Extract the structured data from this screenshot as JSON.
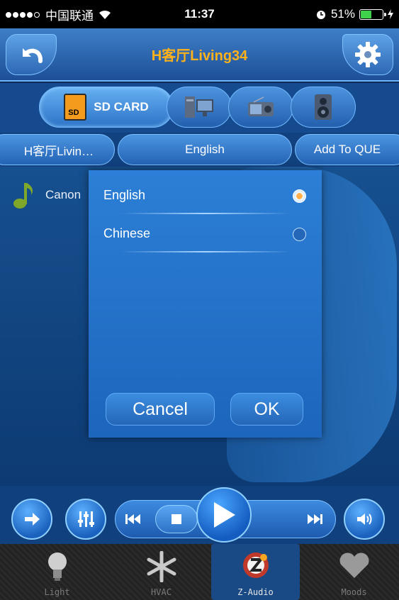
{
  "status_bar": {
    "carrier": "中国联通",
    "time": "11:37",
    "battery": "51%",
    "battery_level": 0.51
  },
  "header": {
    "title": "H客厅Living34",
    "back_icon": "back-arrow-icon",
    "settings_icon": "gear-icon"
  },
  "sources": [
    {
      "label": "SD CARD",
      "icon": "sd-card-icon",
      "selected": true
    },
    {
      "label": "",
      "icon": "pc-tower-icon",
      "selected": false
    },
    {
      "label": "",
      "icon": "radio-icon",
      "selected": false
    },
    {
      "label": "",
      "icon": "speaker-icon",
      "selected": false
    }
  ],
  "nav": {
    "room": "H客厅Livin…",
    "language": "English",
    "add_queue": "Add To QUE"
  },
  "track": {
    "name": "Canon"
  },
  "dialog": {
    "options": [
      {
        "label": "English",
        "selected": true
      },
      {
        "label": "Chinese",
        "selected": false
      }
    ],
    "cancel": "Cancel",
    "ok": "OK"
  },
  "tabs": [
    {
      "label": "Light",
      "icon": "light-bulb-icon",
      "active": false
    },
    {
      "label": "HVAC",
      "icon": "snowflake-icon",
      "active": false
    },
    {
      "label": "Z-Audio",
      "icon": "z-audio-icon",
      "active": true
    },
    {
      "label": "Moods",
      "icon": "heart-icon",
      "active": false
    }
  ],
  "colors": {
    "title_accent": "#ffb21a",
    "background": "#0b2a55"
  }
}
